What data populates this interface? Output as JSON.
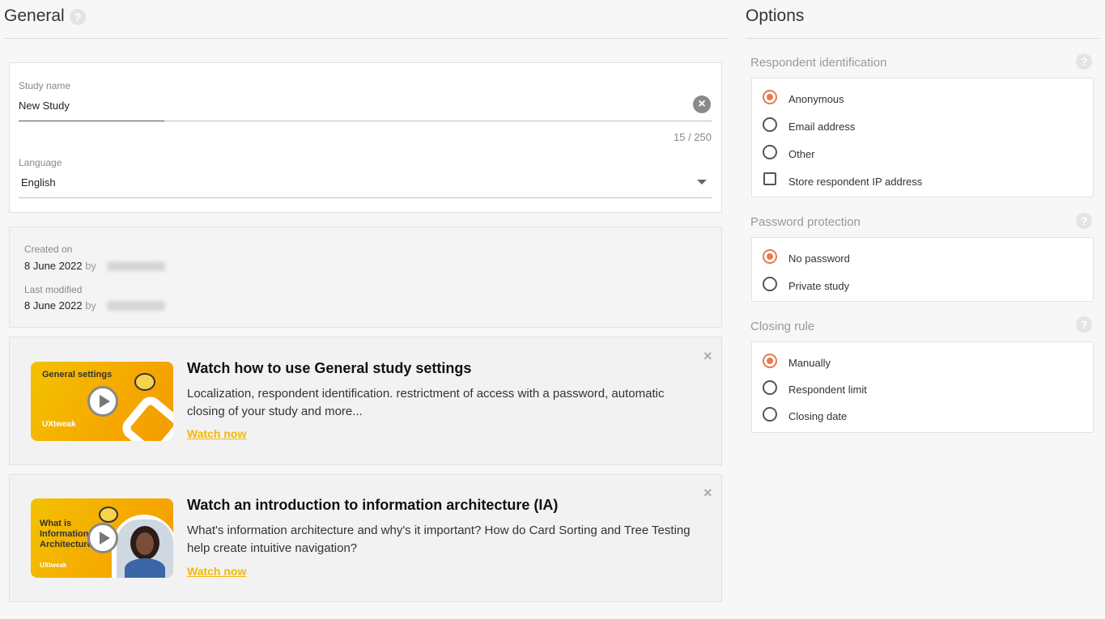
{
  "general": {
    "title": "General",
    "help": "?",
    "study_name": {
      "label": "Study name",
      "value": "New Study",
      "counter": "15 / 250"
    },
    "language": {
      "label": "Language",
      "value": "English"
    },
    "created": {
      "label": "Created on",
      "date": "8 June 2022",
      "by": "by"
    },
    "modified": {
      "label": "Last modified",
      "date": "8 June 2022",
      "by": "by"
    }
  },
  "promos": [
    {
      "title": "Watch how to use General study settings",
      "description": "Localization, respondent identification. restrictment of access with a password, automatic closing of your study and more...",
      "link": "Watch now",
      "thumb_title": "General settings",
      "thumb_brand": "UXtweak"
    },
    {
      "title": "Watch an introduction to information architecture (IA)",
      "description": "What's information architecture and why's it important? How do Card Sorting and Tree Testing help create intuitive navigation?",
      "link": "Watch now",
      "thumb_title": "What is Information Architecture",
      "thumb_brand": "UXtweak"
    }
  ],
  "options": {
    "title": "Options",
    "help": "?",
    "respondent_identification": {
      "title": "Respondent identification",
      "items": [
        "Anonymous",
        "Email address",
        "Other"
      ],
      "selected": "Anonymous",
      "checkbox": "Store respondent IP address"
    },
    "password_protection": {
      "title": "Password protection",
      "items": [
        "No password",
        "Private study"
      ],
      "selected": "No password"
    },
    "closing_rule": {
      "title": "Closing rule",
      "items": [
        "Manually",
        "Respondent limit",
        "Closing date"
      ],
      "selected": "Manually"
    }
  },
  "colors": {
    "accent": "#e8794f",
    "link": "#f2b705"
  }
}
